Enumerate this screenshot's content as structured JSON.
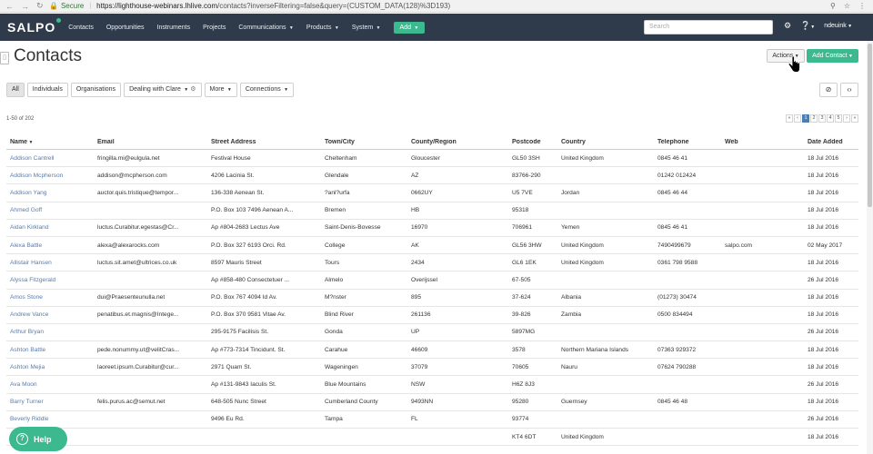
{
  "browser": {
    "secure_label": "Secure",
    "url_host": "https://lighthouse-webinars.lhlive.com",
    "url_path": "/contacts?inverseFiltering=false&query=(CUSTOM_DATA(128)%3D193)"
  },
  "navbar": {
    "logo": "SALPO",
    "items": [
      "Contacts",
      "Opportunities",
      "Instruments",
      "Projects",
      "Communications",
      "Products",
      "System"
    ],
    "add_label": "Add",
    "search_placeholder": "Search",
    "user": "ndeuink"
  },
  "header": {
    "title": "Contacts",
    "actions_label": "Actions",
    "add_contact_label": "Add Contact"
  },
  "filters": {
    "all": "All",
    "individuals": "Individuals",
    "organisations": "Organisations",
    "dealing_with": "Dealing with",
    "dealing_with_value": "Clare",
    "more": "More",
    "connections": "Connections"
  },
  "results": {
    "count_text": "1-50 of 202",
    "pages": [
      "«",
      "‹",
      "1",
      "2",
      "3",
      "4",
      "5",
      "›",
      "»"
    ],
    "current_page": "1"
  },
  "table": {
    "columns": [
      "Name",
      "Email",
      "Street Address",
      "Town/City",
      "County/Region",
      "Postcode",
      "Country",
      "Telephone",
      "Web",
      "Date Added"
    ],
    "rows": [
      [
        "Addison Cantrell",
        "fringilla.mi@eulgula.net",
        "Festival House",
        "Cheltenham",
        "Gloucester",
        "GL50 3SH",
        "United Kingdom",
        "0845 46 41",
        "",
        "18 Jul 2016"
      ],
      [
        "Addison Mcpherson",
        "addison@mcpherson.com",
        "4206 Lacinia St.",
        "Glendale",
        "AZ",
        "83766-290",
        "",
        "01242 012424",
        "",
        "18 Jul 2016"
      ],
      [
        "Addison Yang",
        "auctor.quis.tristique@tempor...",
        "136-338 Aenean St.",
        "?anl?urfa",
        "0662UY",
        "U5 7VE",
        "Jordan",
        "0845 46 44",
        "",
        "18 Jul 2016"
      ],
      [
        "Ahmed Goff",
        "",
        "P.O. Box 103 7496 Aenean A...",
        "Bremen",
        "HB",
        "95318",
        "",
        "",
        "",
        "18 Jul 2016"
      ],
      [
        "Aidan Kirkland",
        "luctus.Curabitur.egestas@Cr...",
        "Ap #804-2683 Lectus Ave",
        "Saint-Denis-Bovesse",
        "16970",
        "706961",
        "Yemen",
        "0845 46 41",
        "",
        "18 Jul 2016"
      ],
      [
        "Alexa Battle",
        "alexa@alexarocks.com",
        "P.O. Box 327 6193 Orci. Rd.",
        "College",
        "AK",
        "GL56 3HW",
        "United Kingdom",
        "7490499679",
        "salpo.com",
        "02 May 2017"
      ],
      [
        "Allistair Hansen",
        "luctus.sit.amet@ultrices.co.uk",
        "8597 Mauris Street",
        "Tours",
        "2434",
        "GL6 1EK",
        "United Kingdom",
        "0361 798 9588",
        "",
        "18 Jul 2016"
      ],
      [
        "Alyssa Fitzgerald",
        "",
        "Ap #858-480 Consectetuer ...",
        "Almelo",
        "Overijssel",
        "67-505",
        "",
        "",
        "",
        "26 Jul 2016"
      ],
      [
        "Amos Stone",
        "dui@Praesenteunulla.net",
        "P.O. Box 767 4094 Id Av.",
        "M?nster",
        "895",
        "37-624",
        "Albania",
        "(01273) 30474",
        "",
        "18 Jul 2016"
      ],
      [
        "Andrew Vance",
        "penatibus.et.magnis@Intege...",
        "P.O. Box 370 9581 Vitae Av.",
        "Blind River",
        "261136",
        "39-826",
        "Zambia",
        "0500 834494",
        "",
        "18 Jul 2016"
      ],
      [
        "Arthur Bryan",
        "",
        "295-9175 Facilisis St.",
        "Gonda",
        "UP",
        "5897MG",
        "",
        "",
        "",
        "26 Jul 2016"
      ],
      [
        "Ashton Battle",
        "pede.nonummy.ut@velitCras...",
        "Ap #773-7314 Tincidunt. St.",
        "Carahue",
        "46609",
        "3578",
        "Northern Mariana Islands",
        "07363 929372",
        "",
        "18 Jul 2016"
      ],
      [
        "Ashton Mejia",
        "laoreet.ipsum.Curabitur@cur...",
        "2971 Quam St.",
        "Wageningen",
        "37079",
        "70605",
        "Nauru",
        "07624 790288",
        "",
        "18 Jul 2016"
      ],
      [
        "Ava Moon",
        "",
        "Ap #131-9843 Iaculis St.",
        "Blue Mountains",
        "NSW",
        "H6Z 8J3",
        "",
        "",
        "",
        "26 Jul 2016"
      ],
      [
        "Barry Turner",
        "felis.purus.ac@semut.net",
        "648-505 Nunc Street",
        "Cumberland County",
        "9493NN",
        "95280",
        "Guernsey",
        "0845 46 48",
        "",
        "18 Jul 2016"
      ],
      [
        "Beverly Riddle",
        "",
        "9496 Eu Rd.",
        "Tampa",
        "FL",
        "93774",
        "",
        "",
        "",
        "26 Jul 2016"
      ],
      [
        "",
        "",
        "",
        "",
        "",
        "KT4 6DT",
        "United Kingdom",
        "",
        "",
        "18 Jul 2016"
      ]
    ]
  },
  "help": {
    "label": "Help"
  }
}
